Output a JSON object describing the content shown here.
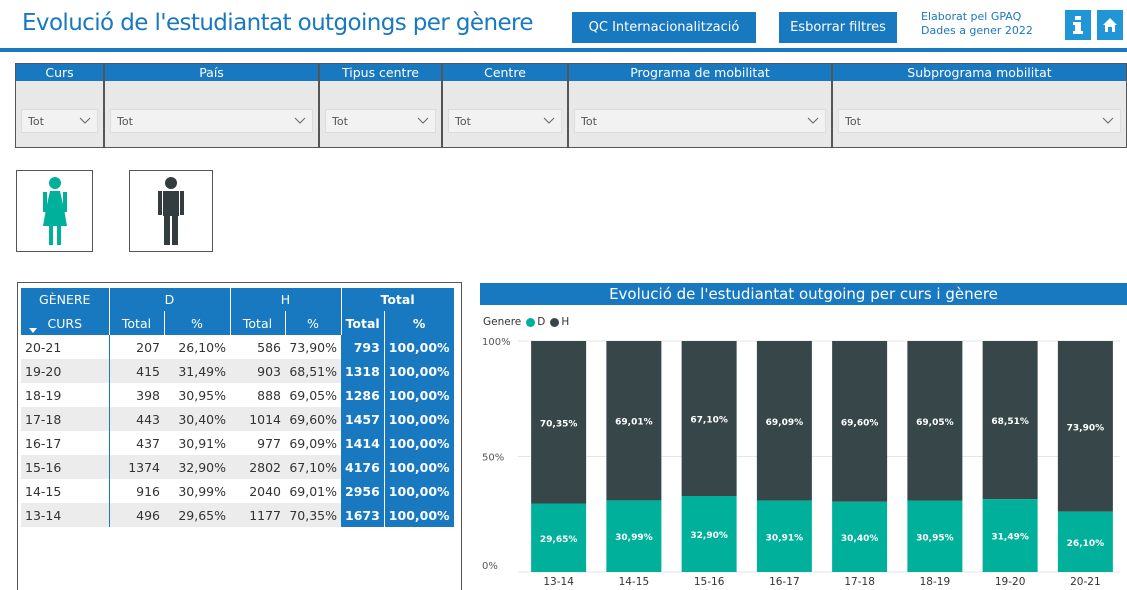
{
  "header": {
    "title": "Evolució de l'estudiantat outgoings per gènere",
    "btn_qc": "QC Internacionalització",
    "btn_clear": "Esborrar filtres",
    "info_line1": "Elaborat pel GPAQ",
    "info_line2": "Dades a gener 2022",
    "info_icon": "info-icon",
    "home_icon": "home-icon",
    "accent_color": "#1878c0"
  },
  "filters": [
    {
      "label": "Curs",
      "value": "Tot"
    },
    {
      "label": "País",
      "value": "Tot"
    },
    {
      "label": "Tipus centre",
      "value": "Tot"
    },
    {
      "label": "Centre",
      "value": "Tot"
    },
    {
      "label": "Programa de mobilitat",
      "value": "Tot"
    },
    {
      "label": "Subprograma mobilitat",
      "value": "Tot"
    }
  ],
  "gender_buttons": [
    {
      "icon": "female-icon",
      "color": "#00b09b"
    },
    {
      "icon": "male-icon",
      "color": "#333d40"
    }
  ],
  "table": {
    "header_genere": "GÈNERE",
    "header_d": "D",
    "header_h": "H",
    "header_total": "Total",
    "header_curs": "CURS",
    "sub_total": "Total",
    "sub_pct": "%",
    "rows": [
      [
        "20-21",
        "207",
        "26,10%",
        "586",
        "73,90%",
        "793",
        "100,00%"
      ],
      [
        "19-20",
        "415",
        "31,49%",
        "903",
        "68,51%",
        "1318",
        "100,00%"
      ],
      [
        "18-19",
        "398",
        "30,95%",
        "888",
        "69,05%",
        "1286",
        "100,00%"
      ],
      [
        "17-18",
        "443",
        "30,40%",
        "1014",
        "69,60%",
        "1457",
        "100,00%"
      ],
      [
        "16-17",
        "437",
        "30,91%",
        "977",
        "69,09%",
        "1414",
        "100,00%"
      ],
      [
        "15-16",
        "1374",
        "32,90%",
        "2802",
        "67,10%",
        "4176",
        "100,00%"
      ],
      [
        "14-15",
        "916",
        "30,99%",
        "2040",
        "69,01%",
        "2956",
        "100,00%"
      ],
      [
        "13-14",
        "496",
        "29,65%",
        "1177",
        "70,35%",
        "1673",
        "100,00%"
      ]
    ]
  },
  "chart_data": {
    "type": "bar",
    "title": "Evolució de l'estudiantat outgoing per curs i gènere",
    "legend_title": "Genere",
    "legend_position": "top-left",
    "stacked": true,
    "categories": [
      "13-14",
      "14-15",
      "15-16",
      "16-17",
      "17-18",
      "18-19",
      "19-20",
      "20-21"
    ],
    "series": [
      {
        "name": "D",
        "color": "#00b09b",
        "values": [
          29.65,
          30.99,
          32.9,
          30.91,
          30.4,
          30.95,
          31.49,
          26.1
        ],
        "labels": [
          "29,65%",
          "30,99%",
          "32,90%",
          "30,91%",
          "30,40%",
          "30,95%",
          "31,49%",
          "26,10%"
        ]
      },
      {
        "name": "H",
        "color": "#374649",
        "values": [
          70.35,
          69.01,
          67.1,
          69.09,
          69.6,
          69.05,
          68.51,
          73.9
        ],
        "labels": [
          "70,35%",
          "69,01%",
          "67,10%",
          "69,09%",
          "69,60%",
          "69,05%",
          "68,51%",
          "73,90%"
        ]
      }
    ],
    "y_ticks": [
      "100%",
      "50%",
      "0%"
    ],
    "ylim": [
      0,
      100
    ],
    "grid": true
  }
}
